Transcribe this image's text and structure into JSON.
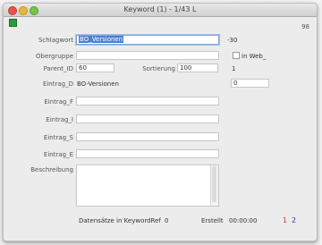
{
  "window": {
    "title": "Keyword (1) - 1/43 L"
  },
  "header": {
    "right_text": "98"
  },
  "form": {
    "schlagwort": {
      "label": "Schlagwort",
      "value": "BO_Versionen",
      "suffix": "-30"
    },
    "obergruppe": {
      "label": "Obergruppe",
      "value": ""
    },
    "in_web": {
      "label": "in Web_"
    },
    "parent_id": {
      "label": "Parent_ID",
      "value": "60"
    },
    "sortierung": {
      "label": "Sortierung",
      "value": "100"
    },
    "right_num": "1",
    "eintrag_d": {
      "label": "Eintrag_D",
      "value": "BO-Versionen",
      "right_value": "0"
    },
    "eintrag_f": {
      "label": "Eintrag_F",
      "value": ""
    },
    "eintrag_i": {
      "label": "Eintrag_I",
      "value": ""
    },
    "eintrag_s": {
      "label": "Eintrag_S",
      "value": ""
    },
    "eintrag_e": {
      "label": "Eintrag_E",
      "value": ""
    },
    "beschreibung": {
      "label": "Beschreibung",
      "value": ""
    }
  },
  "footer": {
    "count_label": "Datensätze in KeywordRef",
    "count_value": "0",
    "erstellt_label": "Erstellt",
    "erstellt_value": "00:00:00",
    "nav_1": "1",
    "nav_2": "2"
  },
  "colors": {
    "accent": "#4f7fd4",
    "nav_1": "#c0392b",
    "nav_2": "#2c3e9e",
    "flag": "#2e9c3a"
  }
}
